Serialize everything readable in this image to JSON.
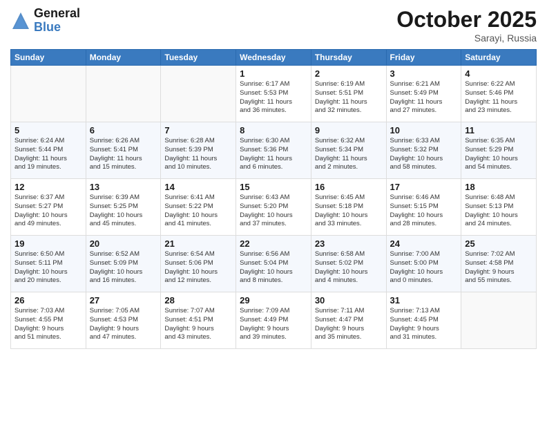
{
  "header": {
    "logo_line1": "General",
    "logo_line2": "Blue",
    "month": "October 2025",
    "location": "Sarayi, Russia"
  },
  "weekdays": [
    "Sunday",
    "Monday",
    "Tuesday",
    "Wednesday",
    "Thursday",
    "Friday",
    "Saturday"
  ],
  "weeks": [
    [
      {
        "day": "",
        "info": ""
      },
      {
        "day": "",
        "info": ""
      },
      {
        "day": "",
        "info": ""
      },
      {
        "day": "1",
        "info": "Sunrise: 6:17 AM\nSunset: 5:53 PM\nDaylight: 11 hours\nand 36 minutes."
      },
      {
        "day": "2",
        "info": "Sunrise: 6:19 AM\nSunset: 5:51 PM\nDaylight: 11 hours\nand 32 minutes."
      },
      {
        "day": "3",
        "info": "Sunrise: 6:21 AM\nSunset: 5:49 PM\nDaylight: 11 hours\nand 27 minutes."
      },
      {
        "day": "4",
        "info": "Sunrise: 6:22 AM\nSunset: 5:46 PM\nDaylight: 11 hours\nand 23 minutes."
      }
    ],
    [
      {
        "day": "5",
        "info": "Sunrise: 6:24 AM\nSunset: 5:44 PM\nDaylight: 11 hours\nand 19 minutes."
      },
      {
        "day": "6",
        "info": "Sunrise: 6:26 AM\nSunset: 5:41 PM\nDaylight: 11 hours\nand 15 minutes."
      },
      {
        "day": "7",
        "info": "Sunrise: 6:28 AM\nSunset: 5:39 PM\nDaylight: 11 hours\nand 10 minutes."
      },
      {
        "day": "8",
        "info": "Sunrise: 6:30 AM\nSunset: 5:36 PM\nDaylight: 11 hours\nand 6 minutes."
      },
      {
        "day": "9",
        "info": "Sunrise: 6:32 AM\nSunset: 5:34 PM\nDaylight: 11 hours\nand 2 minutes."
      },
      {
        "day": "10",
        "info": "Sunrise: 6:33 AM\nSunset: 5:32 PM\nDaylight: 10 hours\nand 58 minutes."
      },
      {
        "day": "11",
        "info": "Sunrise: 6:35 AM\nSunset: 5:29 PM\nDaylight: 10 hours\nand 54 minutes."
      }
    ],
    [
      {
        "day": "12",
        "info": "Sunrise: 6:37 AM\nSunset: 5:27 PM\nDaylight: 10 hours\nand 49 minutes."
      },
      {
        "day": "13",
        "info": "Sunrise: 6:39 AM\nSunset: 5:25 PM\nDaylight: 10 hours\nand 45 minutes."
      },
      {
        "day": "14",
        "info": "Sunrise: 6:41 AM\nSunset: 5:22 PM\nDaylight: 10 hours\nand 41 minutes."
      },
      {
        "day": "15",
        "info": "Sunrise: 6:43 AM\nSunset: 5:20 PM\nDaylight: 10 hours\nand 37 minutes."
      },
      {
        "day": "16",
        "info": "Sunrise: 6:45 AM\nSunset: 5:18 PM\nDaylight: 10 hours\nand 33 minutes."
      },
      {
        "day": "17",
        "info": "Sunrise: 6:46 AM\nSunset: 5:15 PM\nDaylight: 10 hours\nand 28 minutes."
      },
      {
        "day": "18",
        "info": "Sunrise: 6:48 AM\nSunset: 5:13 PM\nDaylight: 10 hours\nand 24 minutes."
      }
    ],
    [
      {
        "day": "19",
        "info": "Sunrise: 6:50 AM\nSunset: 5:11 PM\nDaylight: 10 hours\nand 20 minutes."
      },
      {
        "day": "20",
        "info": "Sunrise: 6:52 AM\nSunset: 5:09 PM\nDaylight: 10 hours\nand 16 minutes."
      },
      {
        "day": "21",
        "info": "Sunrise: 6:54 AM\nSunset: 5:06 PM\nDaylight: 10 hours\nand 12 minutes."
      },
      {
        "day": "22",
        "info": "Sunrise: 6:56 AM\nSunset: 5:04 PM\nDaylight: 10 hours\nand 8 minutes."
      },
      {
        "day": "23",
        "info": "Sunrise: 6:58 AM\nSunset: 5:02 PM\nDaylight: 10 hours\nand 4 minutes."
      },
      {
        "day": "24",
        "info": "Sunrise: 7:00 AM\nSunset: 5:00 PM\nDaylight: 10 hours\nand 0 minutes."
      },
      {
        "day": "25",
        "info": "Sunrise: 7:02 AM\nSunset: 4:58 PM\nDaylight: 9 hours\nand 55 minutes."
      }
    ],
    [
      {
        "day": "26",
        "info": "Sunrise: 7:03 AM\nSunset: 4:55 PM\nDaylight: 9 hours\nand 51 minutes."
      },
      {
        "day": "27",
        "info": "Sunrise: 7:05 AM\nSunset: 4:53 PM\nDaylight: 9 hours\nand 47 minutes."
      },
      {
        "day": "28",
        "info": "Sunrise: 7:07 AM\nSunset: 4:51 PM\nDaylight: 9 hours\nand 43 minutes."
      },
      {
        "day": "29",
        "info": "Sunrise: 7:09 AM\nSunset: 4:49 PM\nDaylight: 9 hours\nand 39 minutes."
      },
      {
        "day": "30",
        "info": "Sunrise: 7:11 AM\nSunset: 4:47 PM\nDaylight: 9 hours\nand 35 minutes."
      },
      {
        "day": "31",
        "info": "Sunrise: 7:13 AM\nSunset: 4:45 PM\nDaylight: 9 hours\nand 31 minutes."
      },
      {
        "day": "",
        "info": ""
      }
    ]
  ]
}
